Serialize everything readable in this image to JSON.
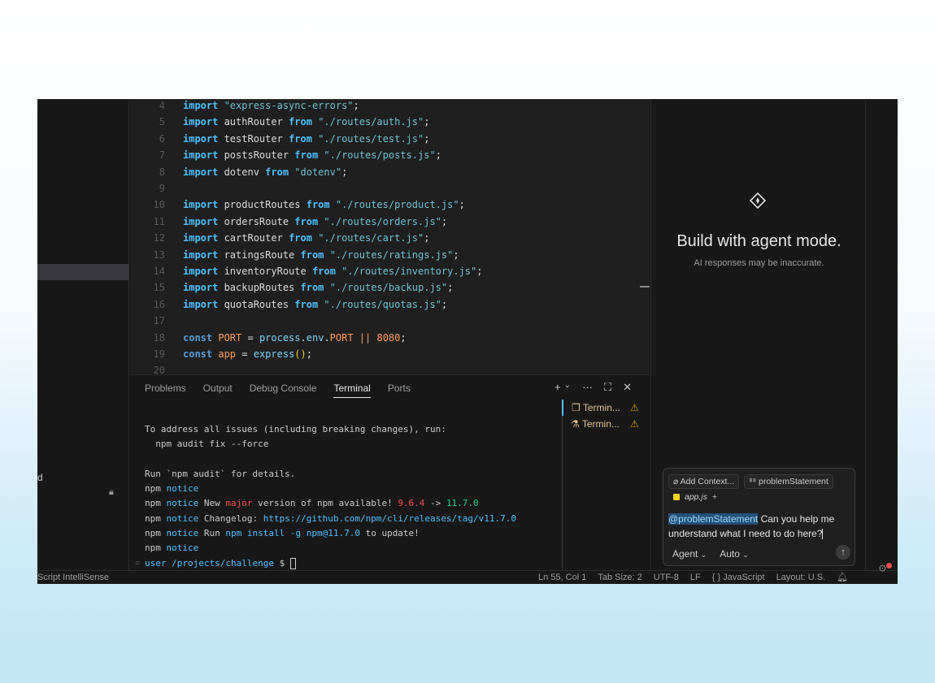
{
  "editor": {
    "lines": [
      {
        "n": "4",
        "html": [
          [
            "kw",
            "import "
          ],
          [
            "str",
            "\"express-async-errors\""
          ],
          [
            "id",
            ";"
          ]
        ]
      },
      {
        "n": "5",
        "html": [
          [
            "kw",
            "import "
          ],
          [
            "id",
            "authRouter "
          ],
          [
            "kw",
            "from "
          ],
          [
            "str",
            "\"./routes/auth.js\""
          ],
          [
            "id",
            ";"
          ]
        ]
      },
      {
        "n": "6",
        "html": [
          [
            "kw",
            "import "
          ],
          [
            "id",
            "testRouter "
          ],
          [
            "kw",
            "from "
          ],
          [
            "str",
            "\"./routes/test.js\""
          ],
          [
            "id",
            ";"
          ]
        ]
      },
      {
        "n": "7",
        "html": [
          [
            "kw",
            "import "
          ],
          [
            "id",
            "postsRouter "
          ],
          [
            "kw",
            "from "
          ],
          [
            "str",
            "\"./routes/posts.js\""
          ],
          [
            "id",
            ";"
          ]
        ]
      },
      {
        "n": "8",
        "html": [
          [
            "kw",
            "import "
          ],
          [
            "id",
            "dotenv "
          ],
          [
            "kw",
            "from "
          ],
          [
            "str",
            "\"dotenv\""
          ],
          [
            "id",
            ";"
          ]
        ]
      },
      {
        "n": "9",
        "html": []
      },
      {
        "n": "10",
        "html": [
          [
            "kw",
            "import "
          ],
          [
            "id",
            "productRoutes "
          ],
          [
            "kw",
            "from "
          ],
          [
            "str",
            "\"./routes/product.js\""
          ],
          [
            "id",
            ";"
          ]
        ]
      },
      {
        "n": "11",
        "html": [
          [
            "kw",
            "import "
          ],
          [
            "id",
            "ordersRoute "
          ],
          [
            "kw",
            "from "
          ],
          [
            "str",
            "\"./routes/orders.js\""
          ],
          [
            "id",
            ";"
          ]
        ]
      },
      {
        "n": "12",
        "html": [
          [
            "kw",
            "import "
          ],
          [
            "id",
            "cartRouter "
          ],
          [
            "kw",
            "from "
          ],
          [
            "str",
            "\"./routes/cart.js\""
          ],
          [
            "id",
            ";"
          ]
        ]
      },
      {
        "n": "13",
        "html": [
          [
            "kw",
            "import "
          ],
          [
            "id",
            "ratingsRoute "
          ],
          [
            "kw",
            "from "
          ],
          [
            "str",
            "\"./routes/ratings.js\""
          ],
          [
            "id",
            ";"
          ]
        ]
      },
      {
        "n": "14",
        "html": [
          [
            "kw",
            "import "
          ],
          [
            "id",
            "inventoryRoute "
          ],
          [
            "kw",
            "from "
          ],
          [
            "str",
            "\"./routes/inventory.js\""
          ],
          [
            "id",
            ";"
          ]
        ]
      },
      {
        "n": "15",
        "html": [
          [
            "kw",
            "import "
          ],
          [
            "id",
            "backupRoutes "
          ],
          [
            "kw",
            "from "
          ],
          [
            "str",
            "\"./routes/backup.js\""
          ],
          [
            "id",
            ";"
          ]
        ]
      },
      {
        "n": "16",
        "html": [
          [
            "kw",
            "import "
          ],
          [
            "id",
            "quotaRoutes "
          ],
          [
            "kw",
            "from "
          ],
          [
            "str",
            "\"./routes/quotas.js\""
          ],
          [
            "id",
            ";"
          ]
        ]
      },
      {
        "n": "17",
        "html": []
      },
      {
        "n": "18",
        "html": [
          [
            "kw2",
            "const "
          ],
          [
            "const",
            "PORT "
          ],
          [
            "id",
            "= "
          ],
          [
            "fn",
            "process"
          ],
          [
            "id",
            "."
          ],
          [
            "fn",
            "env"
          ],
          [
            "id",
            "."
          ],
          [
            "const",
            "PORT "
          ],
          [
            "op",
            "|| "
          ],
          [
            "num",
            "8080"
          ],
          [
            "id",
            ";"
          ]
        ]
      },
      {
        "n": "19",
        "html": [
          [
            "kw2",
            "const "
          ],
          [
            "const",
            "app "
          ],
          [
            "id",
            "= "
          ],
          [
            "fn",
            "express"
          ],
          [
            "paren",
            "()"
          ],
          [
            "id",
            ";"
          ]
        ]
      },
      {
        "n": "20",
        "html": []
      }
    ]
  },
  "panel": {
    "tabs": [
      "Problems",
      "Output",
      "Debug Console",
      "Terminal",
      "Ports"
    ],
    "active_tab": "Terminal",
    "actions": [
      "+",
      "⌄",
      "···",
      "⛶",
      "✕"
    ],
    "terminals": [
      {
        "label": "Termin...",
        "warn": "⚠"
      },
      {
        "label": "Termin...",
        "warn": "⚠"
      }
    ],
    "terminal_output": {
      "l1": "To address all issues (including breaking changes), run:",
      "l2": "  npm audit fix --force",
      "l3": "Run `npm audit` for details.",
      "npm": "npm",
      "notice": "notice",
      "l5_a": " New ",
      "l5_major": "major",
      "l5_b": " version of npm available! ",
      "l5_old": "9.6.4",
      "l5_arrow": " -> ",
      "l5_new": "11.7.0",
      "l6_a": " Changelog: ",
      "l6_link": "https://github.com/npm/cli/releases/tag/v11.7.0",
      "l7_a": " Run ",
      "l7_cmd": "npm install -g npm@11.7.0",
      "l7_b": " to update!",
      "prompt_user": "user",
      "prompt_path": " /projects/challenge",
      "prompt_sign": " $ "
    }
  },
  "sidebar": {
    "fragment": "d"
  },
  "chat": {
    "title": "Build with agent mode.",
    "subtitle": "AI responses may be inaccurate.",
    "add_context": "Add Context...",
    "context_chip": "problemStatement",
    "file": "app.js",
    "mention": "@problemStatement",
    "message": " Can you help me understand what I need to do here?",
    "mode": "Agent",
    "model": "Auto"
  },
  "statusbar": {
    "left": "Script IntelliSense",
    "position": "Ln 55, Col 1",
    "tab_size": "Tab Size: 2",
    "encoding": "UTF-8",
    "eol": "LF",
    "language": "{ } JavaScript",
    "layout": "Layout: U.S."
  }
}
